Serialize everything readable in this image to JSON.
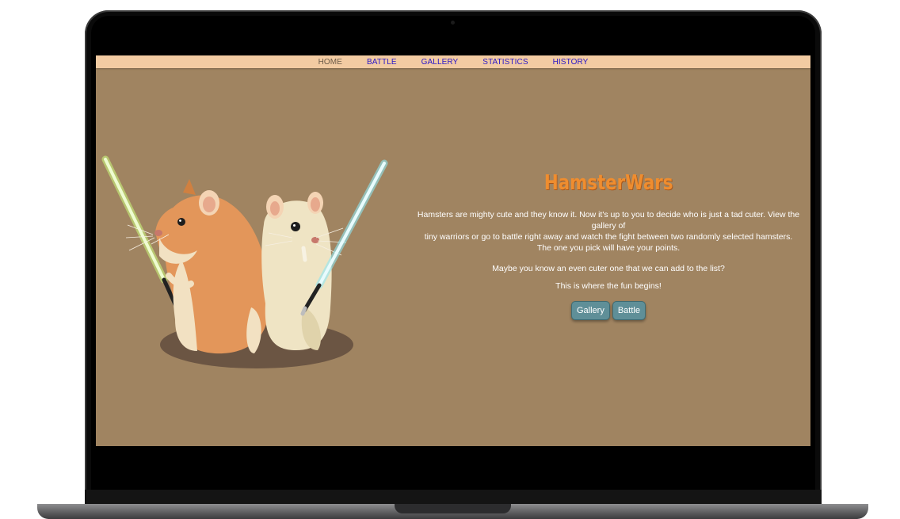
{
  "nav": {
    "items": [
      {
        "label": "HOME",
        "active": true
      },
      {
        "label": "BATTLE",
        "active": false
      },
      {
        "label": "GALLERY",
        "active": false
      },
      {
        "label": "STATISTICS",
        "active": false
      },
      {
        "label": "HISTORY",
        "active": false
      }
    ]
  },
  "hero": {
    "title": "HamsterWars",
    "intro_line1": "Hamsters are mighty cute and they know it. Now it's up to you to decide who is just a tad cuter. View the gallery of",
    "intro_line2": "tiny warriors or go to battle right away and watch the fight between two randomly selected hamsters.",
    "intro_line3": "The one you pick will have your points.",
    "maybe_text": "Maybe you know an even cuter one that we can add to the list?",
    "fun_text": "This is where the fun begins!",
    "buttons": {
      "gallery": "Gallery",
      "battle": "Battle"
    }
  },
  "colors": {
    "page_background": "#a08461",
    "navbar": "#f2cba2",
    "nav_link": "#2a17c9",
    "title": "#ef8d2f",
    "button": "#5f8f98"
  },
  "icons": [
    "hamster-jedi-illustration",
    "green-lightsaber-icon",
    "blue-lightsaber-icon"
  ]
}
